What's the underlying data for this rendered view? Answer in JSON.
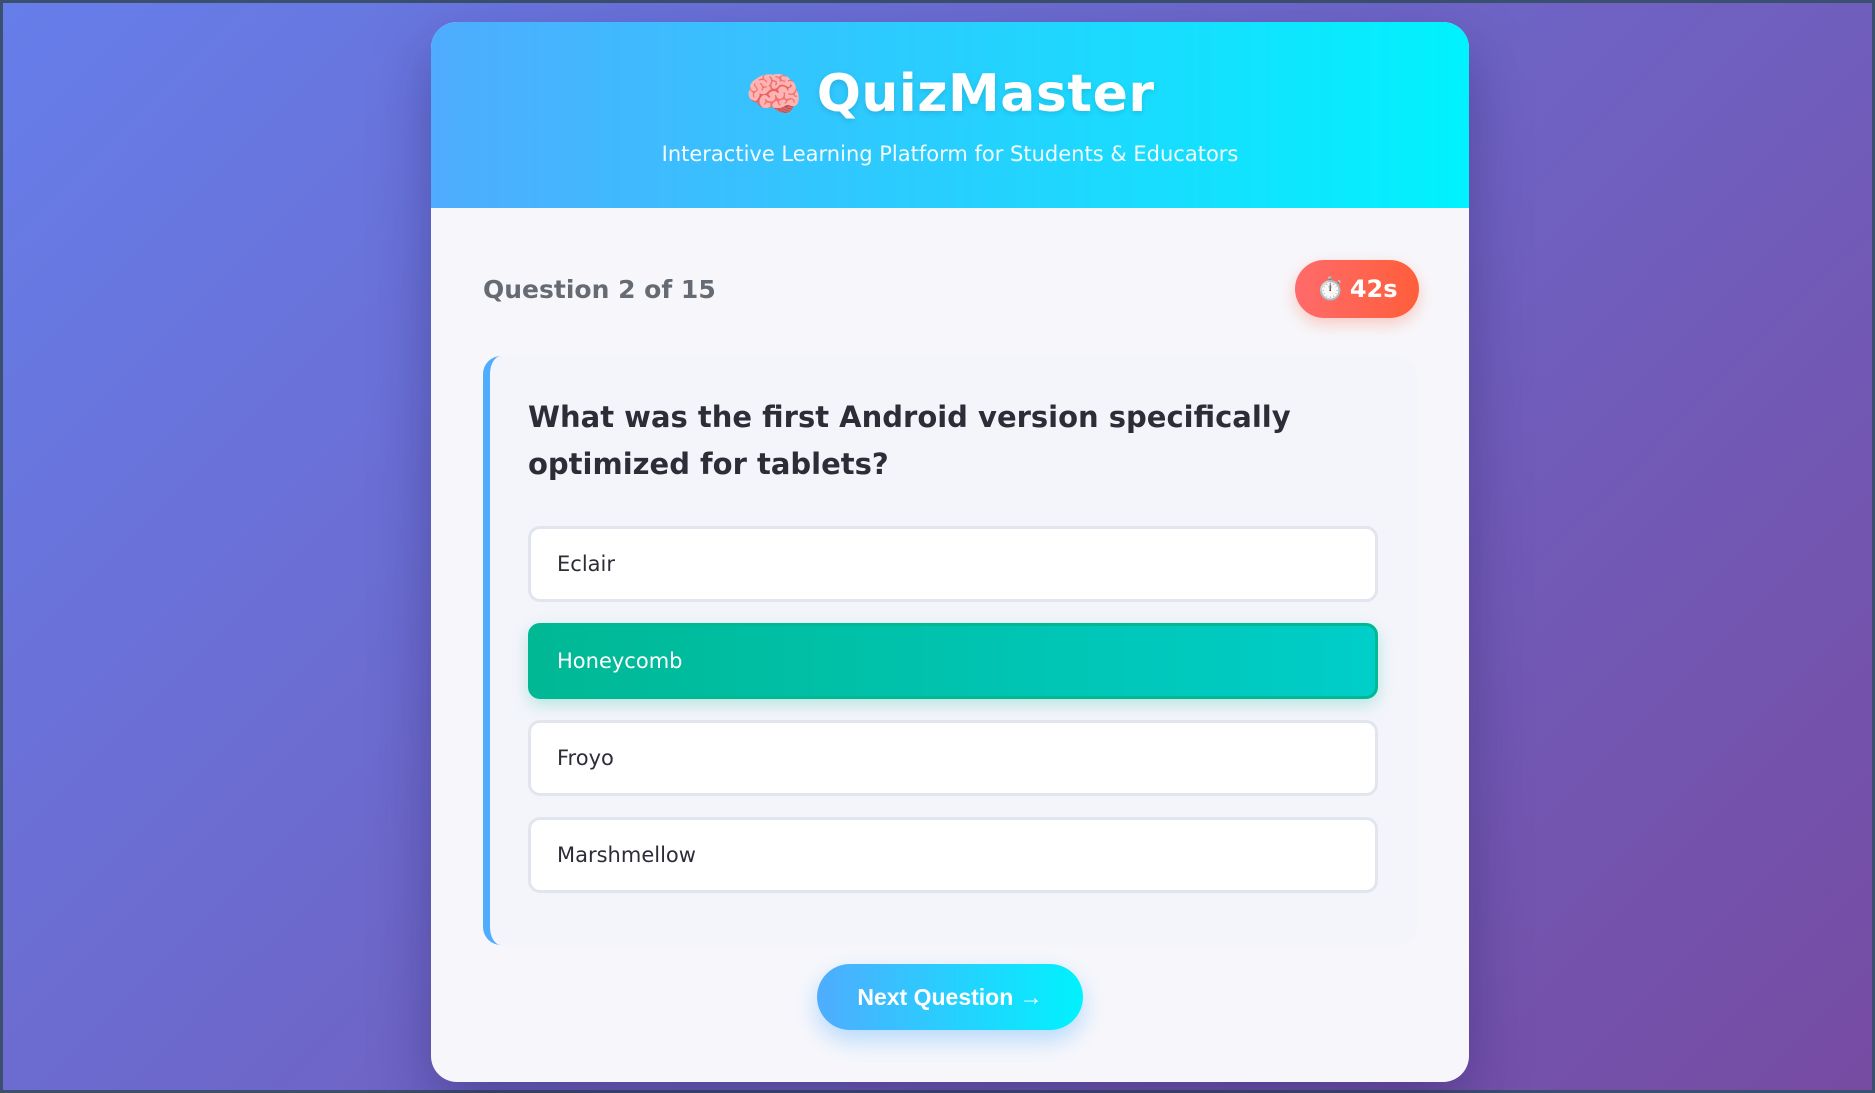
{
  "app": {
    "brand_icon": "🧠",
    "title": "QuizMaster",
    "subtitle": "Interactive Learning Platform for Students & Educators"
  },
  "quiz": {
    "progress_label": "Question 2 of 15",
    "timer_icon": "⏱️",
    "timer_value": "42s",
    "question": "What was the first Android version specifically optimized for tablets?",
    "options": [
      {
        "label": "Eclair",
        "selected": false
      },
      {
        "label": "Honeycomb",
        "selected": true
      },
      {
        "label": "Froyo",
        "selected": false
      },
      {
        "label": "Marshmellow",
        "selected": false
      }
    ],
    "next_label": "Next Question →"
  },
  "colors": {
    "header_gradient": [
      "#4facfe",
      "#00f2fe"
    ],
    "background_gradient": [
      "#667eea",
      "#764ba2"
    ],
    "selected_option": "#00b894",
    "timer": "#ff6b6b"
  }
}
